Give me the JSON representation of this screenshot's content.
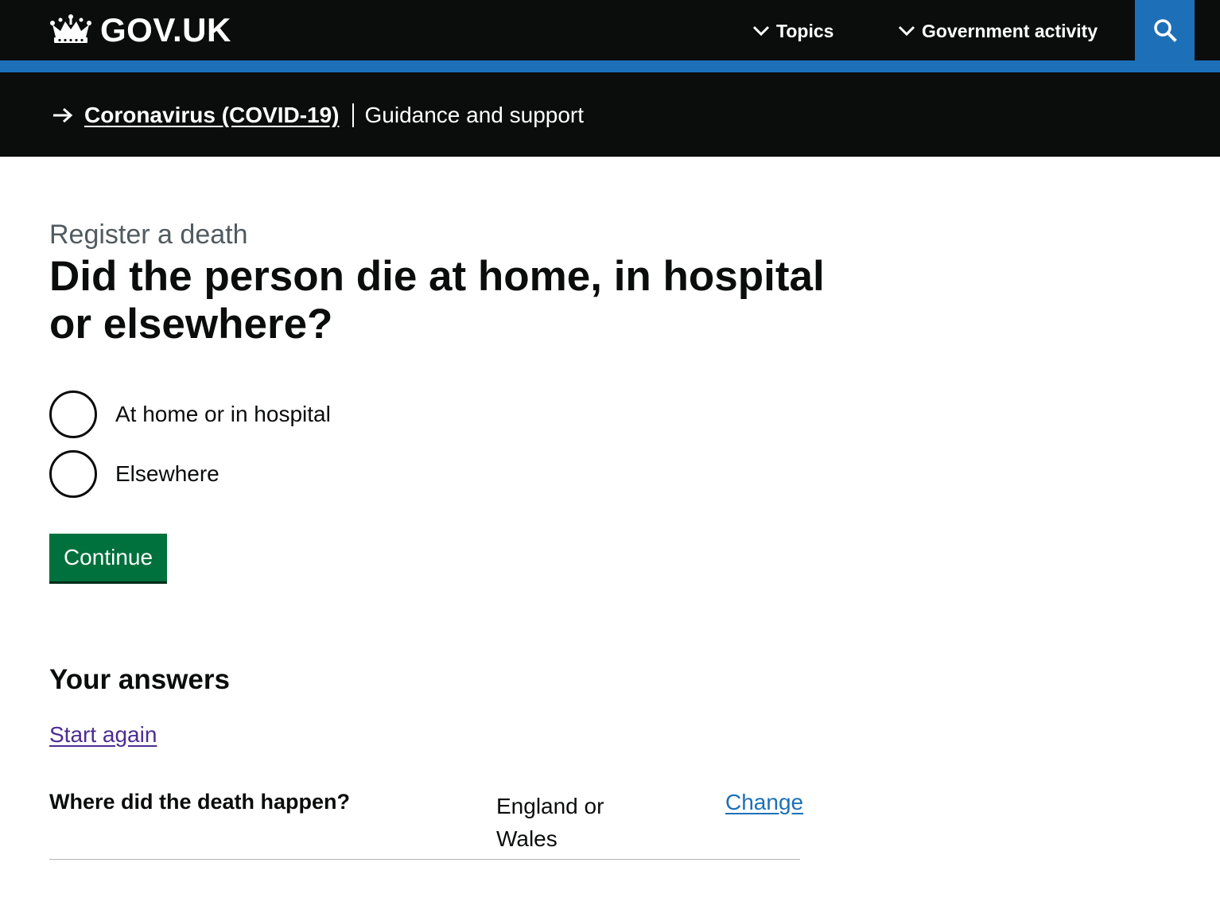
{
  "header": {
    "logo_text": "GOV.UK",
    "nav": [
      {
        "label": "Topics"
      },
      {
        "label": "Government activity"
      }
    ],
    "search_icon": "search-icon"
  },
  "banner": {
    "link_label": "Coronavirus (COVID-19)",
    "text": "Guidance and support"
  },
  "main": {
    "caption": "Register a death",
    "heading": "Did the person die at home, in hospital or elsewhere?",
    "options": [
      {
        "label": "At home or in hospital",
        "checked": false
      },
      {
        "label": "Elsewhere",
        "checked": false
      }
    ],
    "continue_label": "Continue"
  },
  "answers": {
    "heading": "Your answers",
    "start_again": "Start again",
    "rows": [
      {
        "question": "Where did the death happen?",
        "answer": "England or Wales",
        "change": "Change"
      }
    ]
  },
  "colors": {
    "header_bg": "#0b0c0c",
    "accent_blue": "#1d70b8",
    "button_green": "#00703c",
    "visited_link": "#4c2c92",
    "caption_grey": "#505a5f"
  }
}
